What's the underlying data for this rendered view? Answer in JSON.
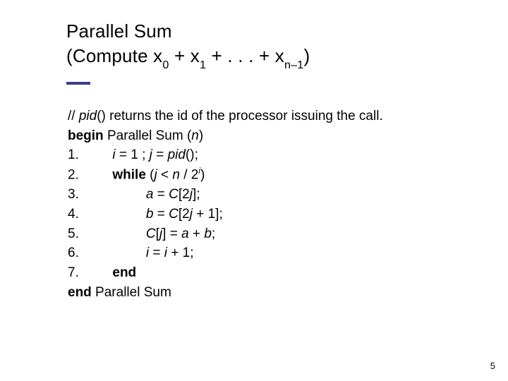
{
  "heading": {
    "line1": "Parallel Sum",
    "line2_prefix": "(Compute x",
    "sub0": "0",
    "plus1": " + x",
    "sub1": "1",
    "dots": " + . . . + x",
    "subn": "n–1",
    "line2_suffix": ")"
  },
  "body": {
    "comment_prefix": "// ",
    "pid": "pid",
    "comment_rest": "() returns the id of the processor issuing the call.",
    "begin_kw": "begin",
    "begin_label": " Parallel Sum (",
    "n": "n",
    "begin_close": ")",
    "l1_num": "1.",
    "l1_i": "i",
    "l1_eq1": " = 1 ; ",
    "l1_j": "j",
    "l1_eqpid": " = ",
    "l1_pid": "pid",
    "l1_tail": "();",
    "l2_num": "2.",
    "l2_while": "while",
    "l2_open": " (",
    "l2_j": "j",
    "l2_lt": " < ",
    "l2_n": "n",
    "l2_slash": " / 2",
    "l2_sup": "i",
    "l2_close": ")",
    "l3_num": "3.",
    "l3_a": "a",
    "l3_eq": " = ",
    "l3_C": "C",
    "l3_open": "[2",
    "l3_j": "j",
    "l3_close": "];",
    "l4_num": "4.",
    "l4_b": "b",
    "l4_eq": " = ",
    "l4_C": "C",
    "l4_open": "[2",
    "l4_j": "j",
    "l4_plus": " + 1];",
    "l5_num": "5.",
    "l5_C": "C",
    "l5_open": "[",
    "l5_j": "j",
    "l5_mid": "] = ",
    "l5_a": "a",
    "l5_plus": " + ",
    "l5_bv": "b",
    "l5_semi": ";",
    "l6_num": "6.",
    "l6_i": "i",
    "l6_eq": " = ",
    "l6_i2": "i",
    "l6_tail": " + 1;",
    "l7_num": "7.",
    "l7_end": "end",
    "end_kw": "end",
    "end_label": " Parallel Sum"
  },
  "page_number": "5"
}
